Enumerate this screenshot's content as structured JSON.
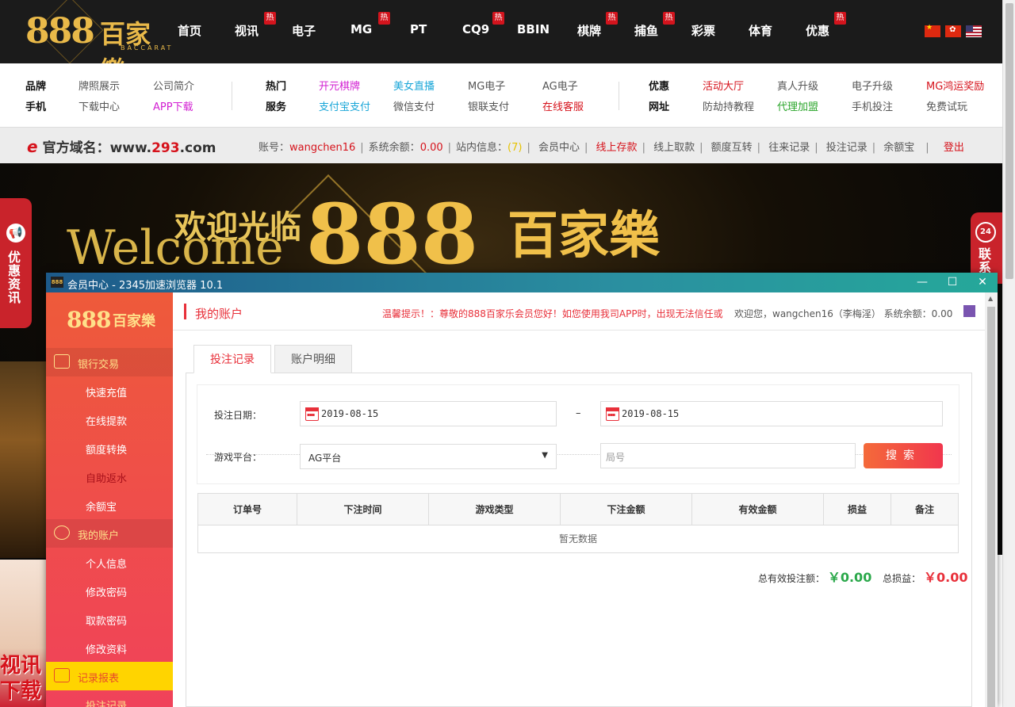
{
  "site": {
    "logo_number": "888",
    "logo_cn": "百家樂",
    "logo_en": "BACCARAT"
  },
  "nav": {
    "items": [
      {
        "label": "首页",
        "hot": false
      },
      {
        "label": "视讯",
        "hot": true
      },
      {
        "label": "电子",
        "hot": false
      },
      {
        "label": "MG",
        "hot": true
      },
      {
        "label": "PT",
        "hot": false
      },
      {
        "label": "CQ9",
        "hot": true
      },
      {
        "label": "BBIN",
        "hot": false
      },
      {
        "label": "棋牌",
        "hot": true
      },
      {
        "label": "捕鱼",
        "hot": true
      },
      {
        "label": "彩票",
        "hot": false
      },
      {
        "label": "体育",
        "hot": false
      },
      {
        "label": "优惠",
        "hot": true
      }
    ],
    "hot_badge": "热",
    "flags": [
      "cn-flag-icon",
      "hk-flag-icon",
      "us-flag-icon"
    ]
  },
  "sublinks": {
    "group1": {
      "h1": "品牌",
      "h2": "手机",
      "links": [
        "牌照展示",
        "公司简介",
        "下载中心",
        "APP下载"
      ]
    },
    "group2": {
      "h1": "热门",
      "h2": "服务",
      "links": [
        "开元棋牌",
        "美女直播",
        "MG电子",
        "AG电子",
        "支付宝支付",
        "微信支付",
        "银联支付",
        "在线客服"
      ]
    },
    "group3": {
      "h1": "优惠",
      "h2": "网址",
      "links": [
        "活动大厅",
        "真人升级",
        "电子升级",
        "MG鸿运奖励",
        "防劫持教程",
        "代理加盟",
        "手机投注",
        "免费试玩"
      ]
    },
    "colors": {
      "magenta": "#d21fd2",
      "cyan": "#19a6d8",
      "red": "#d6131c",
      "green": "#2aa52a"
    }
  },
  "acctbar": {
    "domain_label": "官方域名：www.",
    "domain_num": "293",
    "domain_tld": ".com",
    "account_label": "账号：",
    "account": "wangchen16",
    "balance_label": "系统余额：",
    "balance": "0.00",
    "msg_label": "站内信息：",
    "msg_count": "(7)",
    "links": [
      "会员中心",
      "线上存款",
      "线上取款",
      "额度互转",
      "往来记录",
      "投注记录",
      "余额宝"
    ],
    "logout": "登出"
  },
  "banner": {
    "huanying": "欢迎光临",
    "welcome": "Welcome",
    "b888": "888",
    "bcn": "百家樂",
    "left_float": "优惠资讯",
    "right_float": "联系",
    "right_badge": "24",
    "girl_text": "视讯下载"
  },
  "window": {
    "title": "会员中心 - 2345加速浏览器 10.1",
    "icon_text": "888",
    "minimize": "—",
    "maximize": "☐",
    "close": "✕"
  },
  "side": {
    "logo_number": "888",
    "logo_cn": "百家樂",
    "sections": [
      {
        "label": "银行交易",
        "items": [
          "快速充值",
          "在线提款",
          "额度转换",
          "自助返水",
          "余额宝"
        ]
      },
      {
        "label": "我的账户",
        "items": [
          "个人信息",
          "修改密码",
          "取款密码",
          "修改资料"
        ]
      },
      {
        "label": "记录报表",
        "items": [
          "投注记录"
        ]
      }
    ]
  },
  "content": {
    "title": "我的账户",
    "notice": "温馨提示！：尊敬的888百家乐会员您好！如您使用我司APP时，出现无法信任或",
    "welcome": "欢迎您，wangchen16（李梅淫）  系统余额：0.00",
    "tabs": [
      "投注记录",
      "账户明细"
    ],
    "form": {
      "date_label": "投注日期：",
      "date_from": "2019-08-15",
      "date_sep": "–",
      "date_to": "2019-08-15",
      "platform_label": "游戏平台：",
      "platform_value": "AG平台",
      "round_placeholder": "局号",
      "search": "搜索"
    },
    "table": {
      "columns": [
        "订单号",
        "下注时间",
        "游戏类型",
        "下注金额",
        "有效金额",
        "损益",
        "备注"
      ],
      "rows": [],
      "empty": "暂无数据"
    },
    "totals": {
      "valid_label": "总有效投注额：",
      "valid_value": "￥0.00",
      "profit_label": "总损益：",
      "profit_value": "￥0.00"
    }
  }
}
